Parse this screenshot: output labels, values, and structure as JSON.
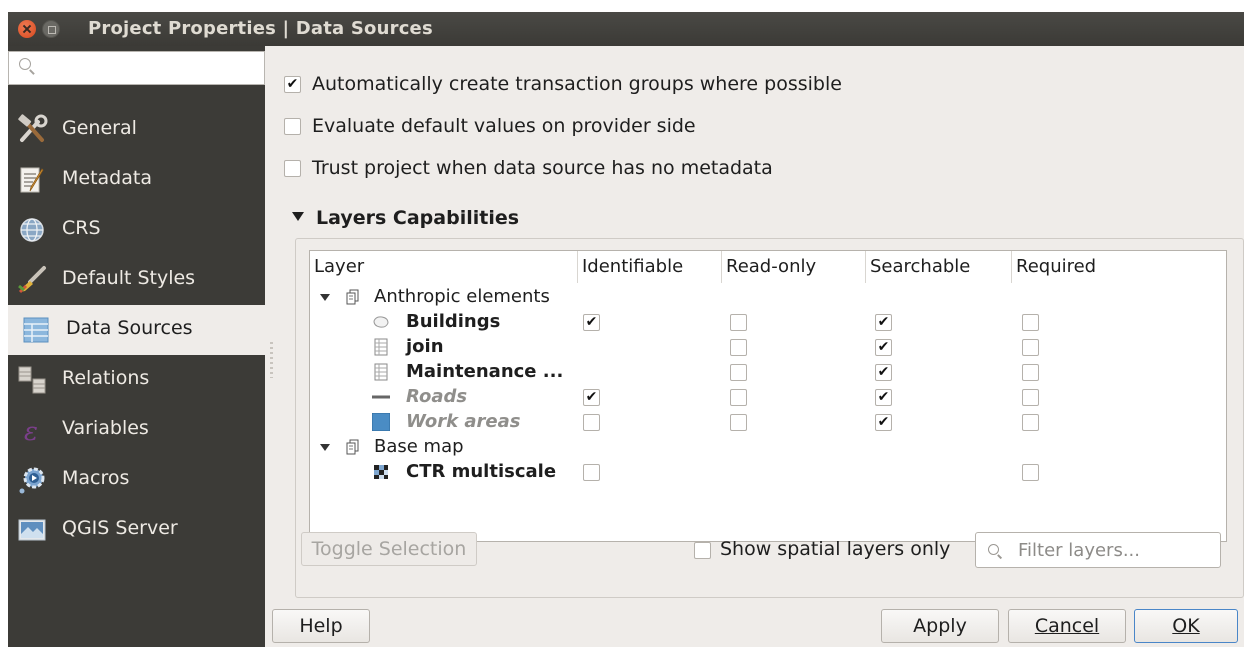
{
  "window": {
    "title": "Project Properties | Data Sources"
  },
  "sidebar": {
    "search_placeholder": "",
    "items": [
      {
        "label": "General",
        "icon": "hammer-wrench-icon"
      },
      {
        "label": "Metadata",
        "icon": "document-pencil-icon"
      },
      {
        "label": "CRS",
        "icon": "globe-icon"
      },
      {
        "label": "Default Styles",
        "icon": "paintbrush-icon"
      },
      {
        "label": "Data Sources",
        "icon": "table-icon",
        "selected": true
      },
      {
        "label": "Relations",
        "icon": "relations-icon"
      },
      {
        "label": "Variables",
        "icon": "epsilon-icon"
      },
      {
        "label": "Macros",
        "icon": "macro-gear-icon"
      },
      {
        "label": "QGIS Server",
        "icon": "server-map-icon"
      }
    ]
  },
  "options": [
    {
      "label": "Automatically create transaction groups where possible",
      "checked": true
    },
    {
      "label": "Evaluate default values on provider side",
      "checked": false
    },
    {
      "label": "Trust project when data source has no metadata",
      "checked": false
    }
  ],
  "capabilities": {
    "title": "Layers Capabilities",
    "columns": [
      "Layer",
      "Identifiable",
      "Read-only",
      "Searchable",
      "Required"
    ],
    "rows": [
      {
        "kind": "group",
        "name": "Anthropic elements"
      },
      {
        "kind": "layer",
        "name": "Buildings",
        "icon": "polygon-layer-icon",
        "style": "bold",
        "identifiable": true,
        "readonly": false,
        "searchable": true,
        "required": false
      },
      {
        "kind": "layer",
        "name": "join",
        "icon": "table-layer-icon",
        "style": "bold",
        "identifiable": null,
        "readonly": false,
        "searchable": true,
        "required": false
      },
      {
        "kind": "layer",
        "name": "Maintenance ...",
        "icon": "table-layer-icon",
        "style": "bold",
        "identifiable": null,
        "readonly": false,
        "searchable": true,
        "required": false
      },
      {
        "kind": "layer",
        "name": "Roads",
        "icon": "line-layer-icon",
        "style": "gray",
        "identifiable": true,
        "readonly": false,
        "searchable": true,
        "required": false
      },
      {
        "kind": "layer",
        "name": "Work areas",
        "icon": "fill-layer-icon",
        "style": "gray",
        "identifiable": false,
        "readonly": false,
        "searchable": true,
        "required": false
      },
      {
        "kind": "group",
        "name": "Base map"
      },
      {
        "kind": "layer",
        "name": "CTR multiscale",
        "icon": "raster-layer-icon",
        "style": "bold",
        "identifiable": false,
        "readonly": null,
        "searchable": null,
        "required": false
      }
    ],
    "toggle_selection_label": "Toggle Selection",
    "show_spatial_label": "Show spatial layers only",
    "show_spatial_checked": false,
    "filter_placeholder": "Filter layers..."
  },
  "buttons": {
    "help": "Help",
    "apply": "Apply",
    "cancel": "Cancel",
    "ok": "OK"
  },
  "colors": {
    "sidebar_bg": "#3c3b37",
    "panel_bg": "#efece9",
    "default_button_border": "#4a86c8"
  }
}
